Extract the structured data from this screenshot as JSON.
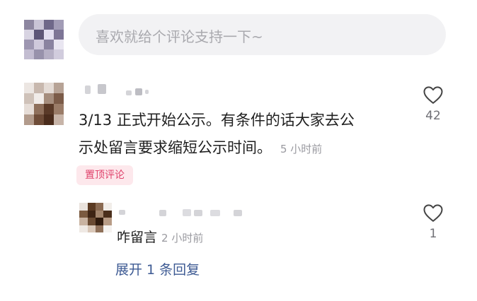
{
  "comment_input": {
    "placeholder": "喜欢就给个评论支持一下~"
  },
  "top_comment": {
    "text_line1": "3/13 正式开始公示。有条件的话大家去公",
    "text_line2": "示处留言要求缩短公示时间。",
    "time": "5 小时前",
    "like_count": "42",
    "badge": "置顶评论",
    "like_icon": "heart-outline-icon"
  },
  "reply": {
    "text": "咋留言",
    "time": "2 小时前",
    "like_count": "1",
    "like_icon": "heart-outline-icon"
  },
  "expand_replies": {
    "label": "展开 1 条回复"
  }
}
